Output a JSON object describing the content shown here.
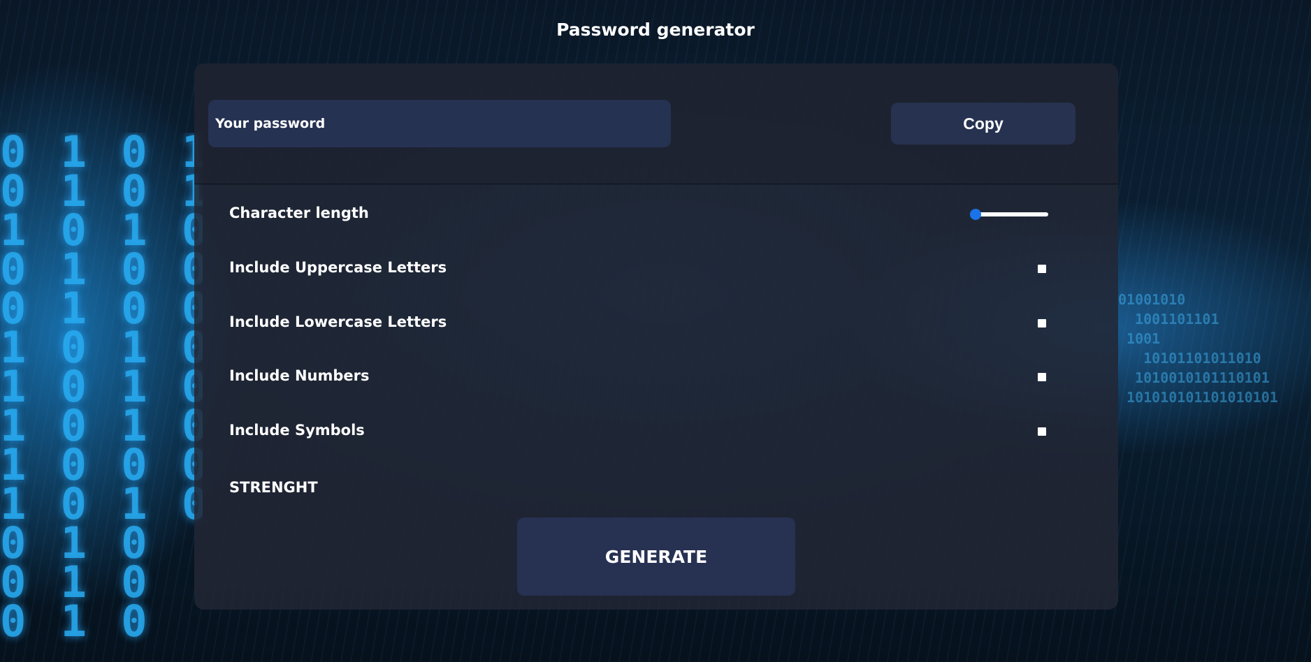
{
  "page": {
    "title": "Password generator"
  },
  "password": {
    "placeholder": "Your password",
    "value": ""
  },
  "copy": {
    "label": "Copy"
  },
  "options": {
    "character_length": {
      "label": "Character length",
      "slider_fraction": 0.0
    },
    "uppercase": {
      "label": "Include Uppercase Letters",
      "checked": false
    },
    "lowercase": {
      "label": "Include Lowercase Letters",
      "checked": false
    },
    "numbers": {
      "label": "Include Numbers",
      "checked": false
    },
    "symbols": {
      "label": "Include Symbols",
      "checked": false
    }
  },
  "strength": {
    "label": "STRENGHT"
  },
  "generate": {
    "label": "GENERATE"
  },
  "colors": {
    "panel": "#222634",
    "field": "#263252",
    "button": "#273251",
    "slider_accent": "#1a73e8",
    "text": "#ffffff"
  },
  "icons": {
    "checkbox": "checkbox-unchecked",
    "slider_thumb": "slider-thumb"
  }
}
